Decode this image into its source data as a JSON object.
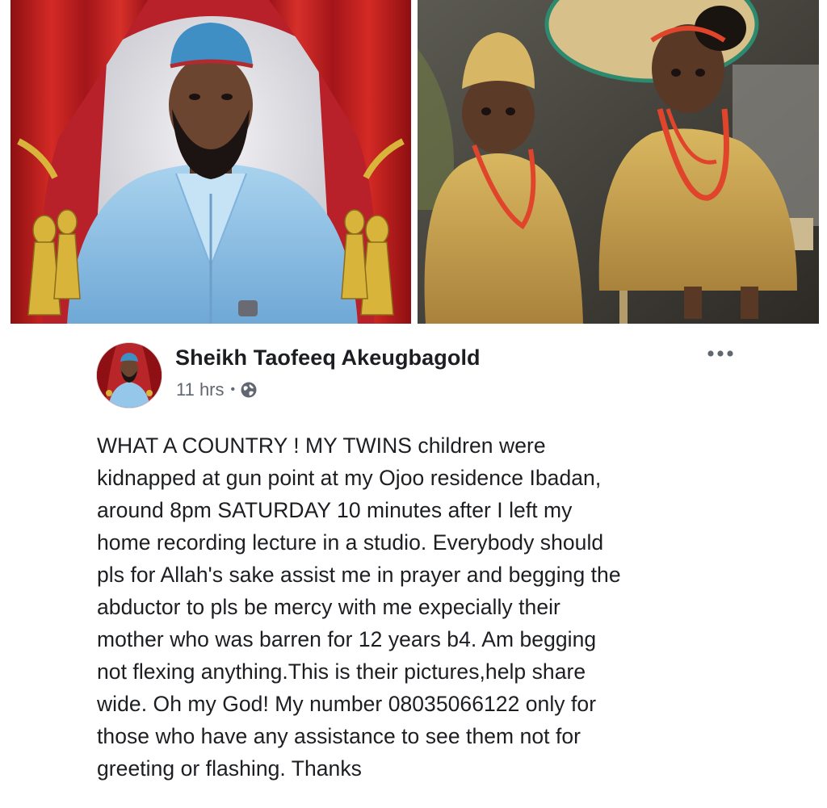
{
  "post": {
    "author_name": "Sheikh Taofeeq Akeugbagold",
    "time": "11 hrs",
    "separator": "•",
    "privacy_icon": "globe-icon",
    "more_icon": "more-options-icon",
    "body": "WHAT A COUNTRY ! MY TWINS children were\nkidnapped at gun point at my Ojoo residence Ibadan,\naround 8pm SATURDAY 10 minutes after I left my\nhome recording lecture in a studio. Everybody should\npls for Allah's sake assist me in prayer and begging the\nabductor to pls be mercy with me expecially their\nmother who was barren for 12 years b4. Am begging\nnot flexing anything.This is their pictures,help share\nwide. Oh my God! My number 08035066122 only for\nthose who have any assistance to see them not for\ngreeting or flashing. Thanks"
  },
  "colors": {
    "curtain_red": "#c91e1e",
    "tassel_gold": "#d9b43a",
    "robe_blue": "#8fc3e6",
    "twin_outfit_gold": "#c9a24a",
    "coral_beads": "#e0452b",
    "text_primary": "#1c1e21",
    "text_secondary": "#606770"
  }
}
